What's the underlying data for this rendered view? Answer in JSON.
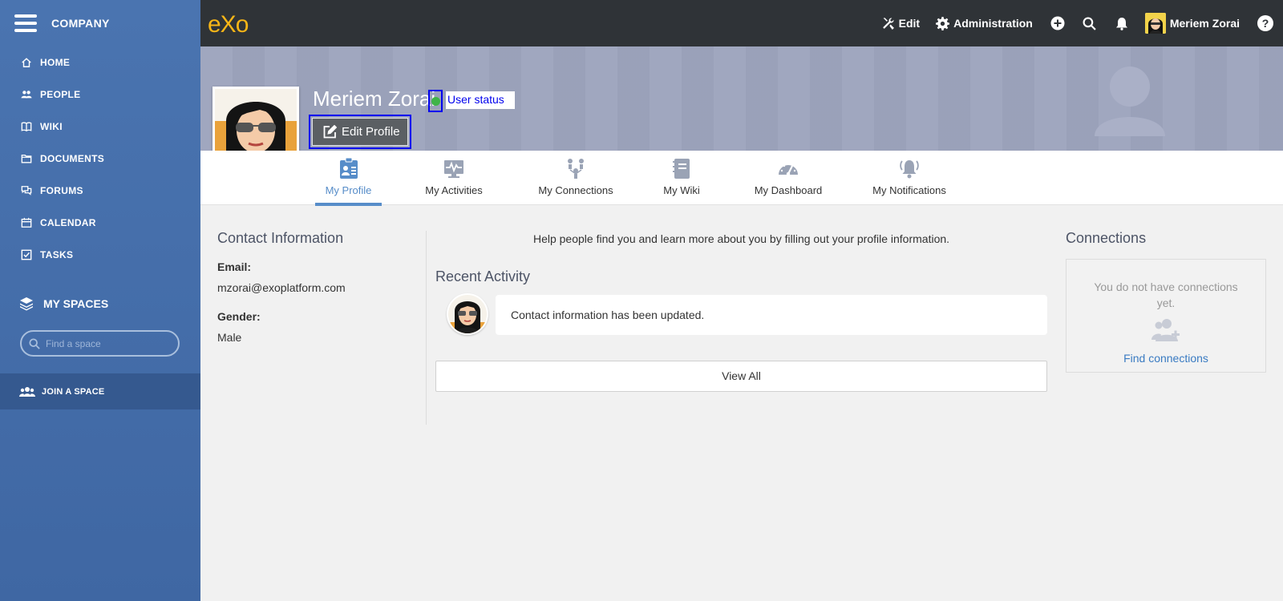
{
  "sidebar": {
    "company": "COMPANY",
    "items": [
      {
        "label": "HOME",
        "icon": "home-icon"
      },
      {
        "label": "PEOPLE",
        "icon": "people-icon"
      },
      {
        "label": "WIKI",
        "icon": "book-icon"
      },
      {
        "label": "DOCUMENTS",
        "icon": "folder-icon"
      },
      {
        "label": "FORUMS",
        "icon": "forum-icon"
      },
      {
        "label": "CALENDAR",
        "icon": "calendar-icon"
      },
      {
        "label": "TASKS",
        "icon": "tasks-icon"
      }
    ],
    "my_spaces": "MY SPACES",
    "search_placeholder": "Find a space",
    "join_space": "JOIN A SPACE"
  },
  "topbar": {
    "logo": "eXo",
    "edit_label": "Edit",
    "admin_label": "Administration",
    "user_name": "Meriem Zorai",
    "help": "?"
  },
  "profile": {
    "name": "Meriem Zorai",
    "status_color": "#3fb447",
    "user_status": "User status",
    "edit_profile": "Edit Profile"
  },
  "tabs": [
    {
      "label": "My Profile",
      "icon": "profile-icon",
      "active": true
    },
    {
      "label": "My Activities",
      "icon": "activities-icon",
      "active": false
    },
    {
      "label": "My Connections",
      "icon": "connections-icon",
      "active": false
    },
    {
      "label": "My Wiki",
      "icon": "wiki-icon",
      "active": false
    },
    {
      "label": "My Dashboard",
      "icon": "dashboard-icon",
      "active": false
    },
    {
      "label": "My Notifications",
      "icon": "notifications-icon",
      "active": false
    }
  ],
  "contact": {
    "title": "Contact Information",
    "email_label": "Email:",
    "email": "mzorai@exoplatform.com",
    "gender_label": "Gender:",
    "gender": "Male"
  },
  "main": {
    "help_text": "Help people find you and learn more about you by filling out your profile information.",
    "recent_title": "Recent Activity",
    "activity_text": "Contact information has been updated.",
    "view_all": "View All"
  },
  "connections": {
    "title": "Connections",
    "empty_text": "You do not have connections yet.",
    "find_link": "Find connections"
  },
  "colors": {
    "sidebar": "#4a74b0",
    "topbar": "#2f3337",
    "accent": "#578dc9",
    "logo": "#f8b617"
  }
}
